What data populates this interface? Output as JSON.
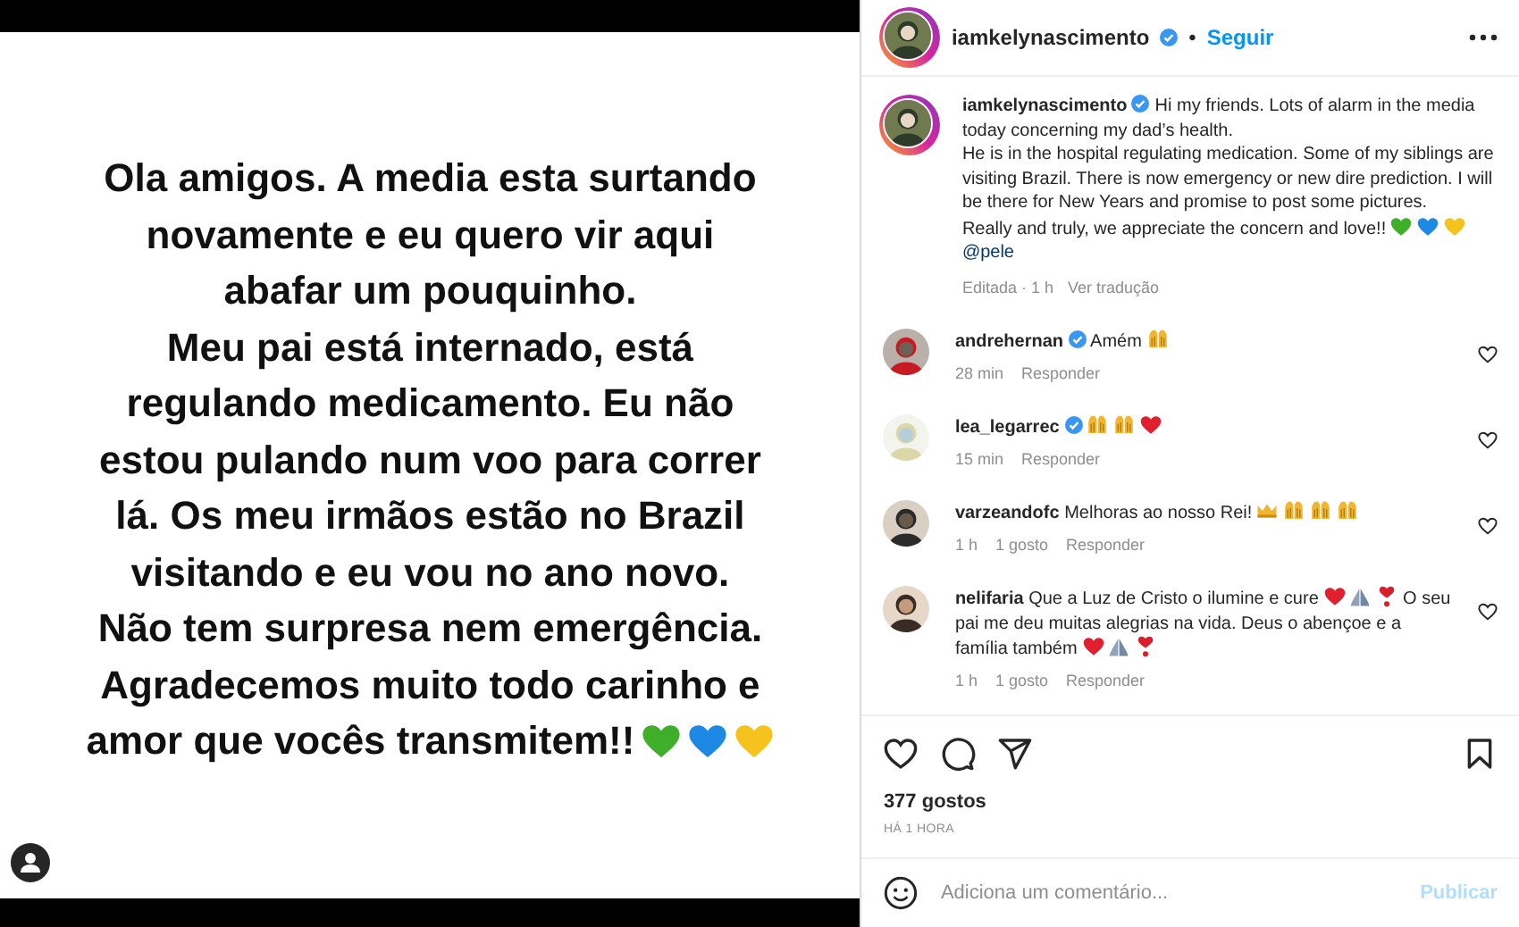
{
  "post_image": {
    "lines": [
      "Ola amigos. A media esta surtando",
      "novamente e eu quero vir aqui",
      "abafar um pouquinho.",
      "Meu pai está internado, está",
      "regulando medicamento. Eu não",
      "estou pulando num voo para correr",
      "lá. Os meu irmãos estão no Brazil",
      "visitando e eu vou no ano novo.",
      "Não tem surpresa nem emergência.",
      "Agradecemos muito todo carinho e",
      "amor que vocês transmitem!!"
    ],
    "emojis": [
      {
        "kind": "heart",
        "color": "#3fae29"
      },
      {
        "kind": "heart",
        "color": "#1e88e5"
      },
      {
        "kind": "heart",
        "color": "#f6c21c"
      }
    ]
  },
  "header": {
    "username": "iamkelynascimento",
    "verified": true,
    "separator": "•",
    "follow": "Seguir"
  },
  "caption": {
    "username": "iamkelynascimento",
    "verified": true,
    "paragraphs": [
      {
        "parts": [
          {
            "kind": "text",
            "text": "Hi my friends. Lots of alarm in the media today concerning my dad’s health."
          }
        ]
      },
      {
        "parts": [
          {
            "kind": "text",
            "text": "He is in the hospital regulating medication. Some of my siblings are visiting Brazil. There is now emergency or new dire prediction. I will be there for New Years and promise to post some pictures."
          }
        ]
      },
      {
        "parts": [
          {
            "kind": "text",
            "text": "Really and truly, we appreciate the concern and love!!"
          },
          {
            "kind": "heart",
            "color": "#3fae29"
          },
          {
            "kind": "heart",
            "color": "#1e88e5"
          },
          {
            "kind": "heart",
            "color": "#f6c21c"
          }
        ]
      }
    ],
    "mention": "@pele",
    "meta": "Editada · 1 h",
    "translate": "Ver tradução"
  },
  "comments": [
    {
      "username": "andrehernan",
      "verified": true,
      "parts": [
        {
          "kind": "text",
          "text": "Amém"
        },
        {
          "kind": "hands"
        }
      ],
      "time": "28 min",
      "reply": "Responder"
    },
    {
      "username": "lea_legarrec",
      "verified": true,
      "parts": [
        {
          "kind": "hands"
        },
        {
          "kind": "hands"
        },
        {
          "kind": "heart",
          "color": "#e0202e"
        }
      ],
      "time": "15 min",
      "reply": "Responder"
    },
    {
      "username": "varzeandofc",
      "verified": false,
      "parts": [
        {
          "kind": "text",
          "text": "Melhoras ao nosso Rei!"
        },
        {
          "kind": "crown"
        },
        {
          "kind": "hands"
        },
        {
          "kind": "hands"
        },
        {
          "kind": "hands"
        }
      ],
      "time": "1 h",
      "likes": "1 gosto",
      "reply": "Responder"
    },
    {
      "username": "nelifaria",
      "verified": false,
      "parts": [
        {
          "kind": "text",
          "text": "Que a Luz de Cristo o ilumine e cure"
        },
        {
          "kind": "heart",
          "color": "#e0202e"
        },
        {
          "kind": "pray"
        },
        {
          "kind": "heart-exclamation"
        },
        {
          "kind": "text",
          "text": "O seu pai me deu muitas alegrias na vida. Deus o abençoe e a família também"
        },
        {
          "kind": "heart",
          "color": "#e0202e"
        },
        {
          "kind": "pray"
        },
        {
          "kind": "heart-exclamation"
        }
      ],
      "time": "1 h",
      "likes": "1 gosto",
      "reply": "Responder"
    }
  ],
  "likes": "377 gostos",
  "posted": "HÁ 1 HORA",
  "comment_box": {
    "placeholder": "Adiciona um comentário...",
    "submit": "Publicar",
    "disabled": true
  }
}
